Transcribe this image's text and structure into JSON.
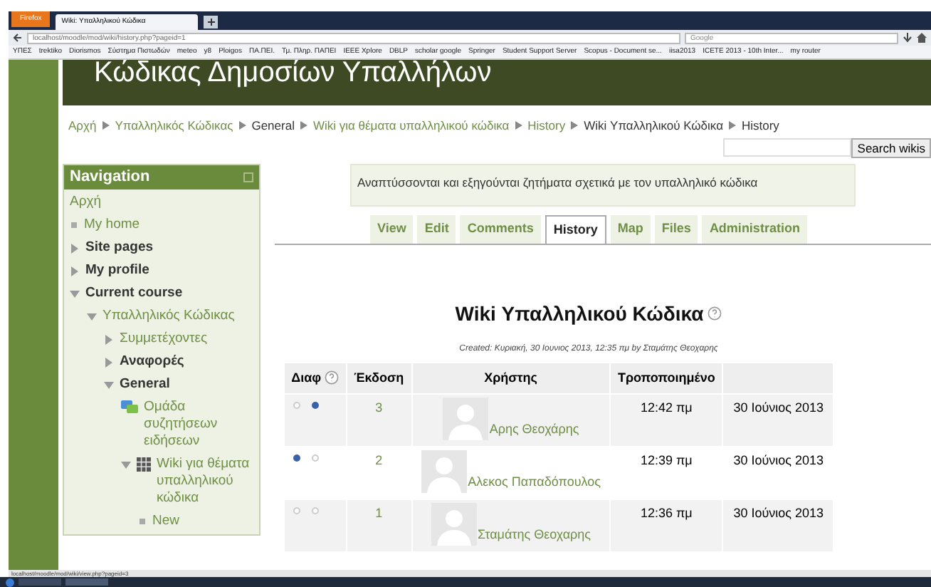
{
  "browser": {
    "menu_button": "Firefox",
    "tab_title": "Wiki: Υπαλληλικού Κώδικα",
    "url": "localhost/moodle/mod/wiki/history.php?pageid=1",
    "search_placeholder": "Google",
    "bookmarks": [
      "ΥΠΕΣ",
      "trektiko",
      "Diorismos",
      "Σύστημα Πιστωδών",
      "meteo",
      "y8",
      "Ploigos",
      "ΠΑ.ΠΕΙ.",
      "Τμ. Πληρ. ΠΑΠΕΙ",
      "IEEE Xplore",
      "DBLP",
      "scholar google",
      "Springer",
      "Student Support Server",
      "Scopus - Document se...",
      "iisa2013",
      "ICETE 2013 - 10th Inter...",
      "my router"
    ],
    "status_url": "localhost/moodle/mod/wiki/view.php?pageid=3"
  },
  "site_title": "Κώδικας Δημοσίων Υπαλλήλων",
  "breadcrumb": [
    {
      "label": "Αρχή",
      "link": true
    },
    {
      "label": "Υπαλληλικός Κώδικας",
      "link": true
    },
    {
      "label": "General",
      "link": false
    },
    {
      "label": "Wiki για θέματα υπαλληλικού κώδικα",
      "link": true
    },
    {
      "label": "History",
      "link": true
    },
    {
      "label": "Wiki Υπαλληλικού Κώδικα",
      "link": false
    },
    {
      "label": "History",
      "link": false
    }
  ],
  "search_button": "Search wikis",
  "navigation": {
    "title": "Navigation",
    "items": [
      {
        "label": "Αρχή",
        "kind": "link",
        "link": true
      },
      {
        "label": "My home",
        "kind": "leaf",
        "link": true
      },
      {
        "label": "Site pages",
        "kind": "branch",
        "expanded": false,
        "link": false
      },
      {
        "label": "My profile",
        "kind": "branch",
        "expanded": false,
        "link": false
      },
      {
        "label": "Current course",
        "kind": "branch",
        "expanded": true,
        "link": false,
        "children": [
          {
            "label": "Υπαλληλικός Κώδικας",
            "kind": "branch",
            "expanded": true,
            "link": true,
            "children": [
              {
                "label": "Συμμετέχοντες",
                "kind": "branch",
                "expanded": false,
                "link": true
              },
              {
                "label": "Αναφορές",
                "kind": "branch",
                "expanded": false,
                "link": false
              },
              {
                "label": "General",
                "kind": "branch",
                "expanded": true,
                "link": false,
                "children": [
                  {
                    "label": "Ομάδα συζητήσεων ειδήσεων",
                    "kind": "forum",
                    "link": true
                  },
                  {
                    "label": "Wiki για θέματα υπαλληλικού κώδικα",
                    "kind": "wiki",
                    "expanded": true,
                    "link": true,
                    "children": [
                      {
                        "label": "New",
                        "kind": "leaf",
                        "link": true
                      }
                    ]
                  }
                ]
              }
            ]
          }
        ]
      }
    ]
  },
  "intro": "Αναπτύσσονται και εξηγούνται ζητήματα σχετικά με τον υπαλληλικό κώδικα",
  "tabs": [
    {
      "label": "View",
      "selected": false
    },
    {
      "label": "Edit",
      "selected": false
    },
    {
      "label": "Comments",
      "selected": false
    },
    {
      "label": "History",
      "selected": true
    },
    {
      "label": "Map",
      "selected": false
    },
    {
      "label": "Files",
      "selected": false
    },
    {
      "label": "Administration",
      "selected": false
    }
  ],
  "page_title": "Wiki Υπαλληλικού Κώδικα",
  "created": "Created: Κυριακή, 30 Ιουνιος 2013, 12:35 πμ by Σταμάτης Θεοχαρης",
  "table": {
    "columns": [
      "Διαφ",
      "Έκδοση",
      "Χρήστης",
      "Τροποποιημένο"
    ],
    "rows": [
      {
        "from_selected": false,
        "to_selected": true,
        "version": "3",
        "user": "Αρης Θεοχάρης",
        "time": "12:42 πμ",
        "date": "30 Ιούνιος 2013"
      },
      {
        "from_selected": true,
        "to_selected": false,
        "version": "2",
        "user": "Αλεκος Παπαδόπουλος",
        "time": "12:39 πμ",
        "date": "30 Ιούνιος 2013"
      },
      {
        "from_selected": false,
        "to_selected": false,
        "version": "1",
        "user": "Σταμάτης Θεοχαρης",
        "time": "12:36 πμ",
        "date": "30 Ιούνιος 2013"
      }
    ]
  }
}
